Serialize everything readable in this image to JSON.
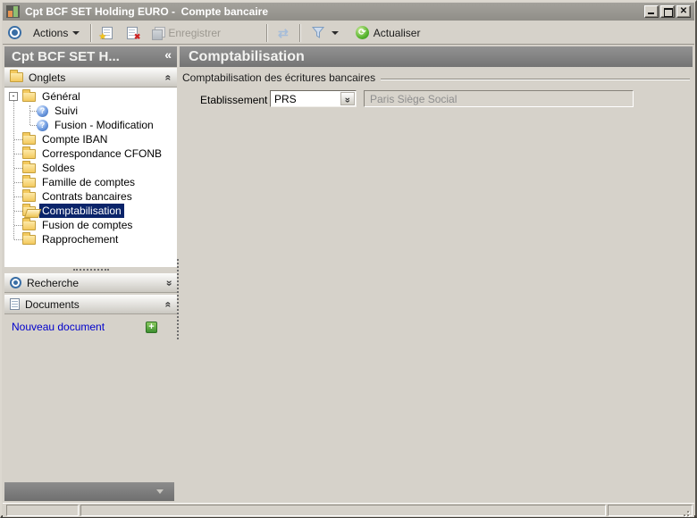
{
  "window": {
    "title": "Cpt BCF SET Holding EURO -  Compte bancaire"
  },
  "toolbar": {
    "actions_label": "Actions",
    "save_label": "Enregistrer",
    "refresh_label": "Actualiser"
  },
  "sidebar": {
    "header_title": "Cpt BCF SET H...",
    "collapse_glyph": "«",
    "sections": {
      "onglets": "Onglets",
      "recherche": "Recherche",
      "documents": "Documents"
    },
    "tree": [
      {
        "label": "Général",
        "icon": "folder",
        "level": 0,
        "expander": true,
        "selected": false
      },
      {
        "label": "Suivi",
        "icon": "help",
        "level": 1,
        "expander": false,
        "selected": false
      },
      {
        "label": "Fusion - Modification",
        "icon": "help",
        "level": 1,
        "expander": false,
        "selected": false
      },
      {
        "label": "Compte IBAN",
        "icon": "folder",
        "level": 0,
        "expander": false,
        "selected": false
      },
      {
        "label": "Correspondance CFONB",
        "icon": "folder",
        "level": 0,
        "expander": false,
        "selected": false
      },
      {
        "label": "Soldes",
        "icon": "folder",
        "level": 0,
        "expander": false,
        "selected": false
      },
      {
        "label": "Famille de comptes",
        "icon": "folder",
        "level": 0,
        "expander": false,
        "selected": false
      },
      {
        "label": "Contrats bancaires",
        "icon": "folder",
        "level": 0,
        "expander": false,
        "selected": false
      },
      {
        "label": "Comptabilisation",
        "icon": "folder-open",
        "level": 0,
        "expander": false,
        "selected": true
      },
      {
        "label": "Fusion de comptes",
        "icon": "folder",
        "level": 0,
        "expander": false,
        "selected": false
      },
      {
        "label": "Rapprochement",
        "icon": "folder",
        "level": 0,
        "expander": false,
        "selected": false
      }
    ],
    "documents": {
      "new_document_label": "Nouveau document"
    }
  },
  "main": {
    "title": "Comptabilisation",
    "group_label": "Comptabilisation des écritures bancaires",
    "field": {
      "label": "Etablissement :",
      "value": "PRS",
      "description": "Paris Siège Social"
    }
  },
  "colors": {
    "selection": "#0a246a",
    "link_blue": "#0000cc",
    "folder_yellow": "#f3c95e",
    "header_gray_top": "#929292",
    "header_gray_bottom": "#747474",
    "accent_green": "#3c8f2f",
    "accent_blue": "#3a6ea5",
    "window_bg": "#d6d2ca"
  }
}
